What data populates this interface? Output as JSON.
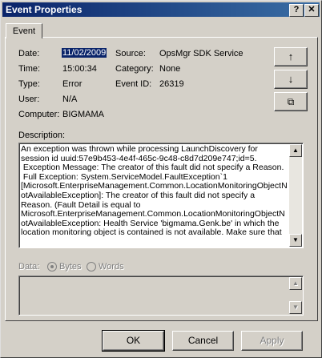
{
  "window": {
    "title": "Event Properties",
    "help": "?",
    "close": "✕"
  },
  "tab": {
    "label": "Event"
  },
  "fields": {
    "date_label": "Date:",
    "date": "11/02/2009",
    "time_label": "Time:",
    "time": "15:00:34",
    "type_label": "Type:",
    "type": "Error",
    "user_label": "User:",
    "user": "N/A",
    "computer_label": "Computer:",
    "computer": "BIGMAMA",
    "source_label": "Source:",
    "source": "OpsMgr SDK Service",
    "category_label": "Category:",
    "category": "None",
    "event_id_label": "Event ID:",
    "event_id": "26319"
  },
  "nav": {
    "up": "↑",
    "down": "↓",
    "copy": "⧉"
  },
  "description": {
    "label": "Description:",
    "text": "An exception was thrown while processing LaunchDiscovery for\nsession id uuid:57e9b453-4e4f-465c-9c48-c8d7d209e747;id=5.\n Exception Message: The creator of this fault did not specify a Reason.\n Full Exception: System.ServiceModel.FaultException`1\n[Microsoft.EnterpriseManagement.Common.LocationMonitoringObjectN\notAvailableException]: The creator of this fault did not specify a\nReason. (Fault Detail is equal to\nMicrosoft.EnterpriseManagement.Common.LocationMonitoringObjectN\notAvailableException: Health Service 'bigmama.Genk.be' in which the\nlocation monitoring object is contained is not available. Make sure that"
  },
  "data": {
    "label": "Data:",
    "bytes": "Bytes",
    "words": "Words",
    "selected": "Bytes"
  },
  "buttons": {
    "ok": "OK",
    "cancel": "Cancel",
    "apply": "Apply"
  }
}
